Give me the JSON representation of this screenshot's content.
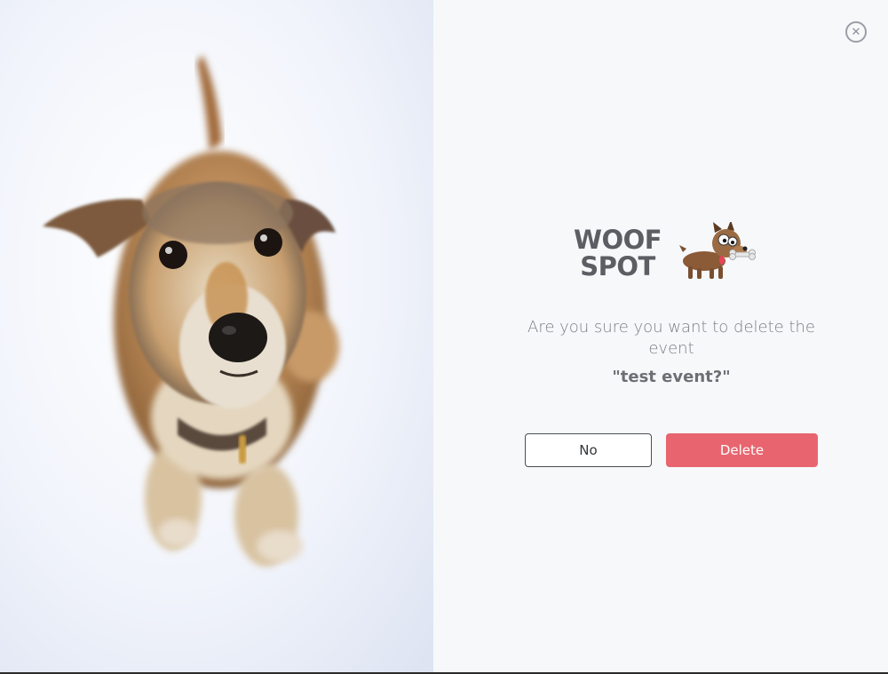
{
  "logo": {
    "line1": "WOOF",
    "line2": "SPOT",
    "mascot_icon": "cartoon-dog-with-bone-icon"
  },
  "dialog": {
    "close_icon": "circle-x-close-icon",
    "message": "Are you sure you want to delete the event",
    "event_name": "\"test event?\"",
    "no_label": "No",
    "delete_label": "Delete"
  },
  "colors": {
    "delete_button": "#e8656f",
    "panel_background": "#f7f8fa",
    "logo_text": "#5b5e62",
    "message_text": "#7b7e84"
  }
}
